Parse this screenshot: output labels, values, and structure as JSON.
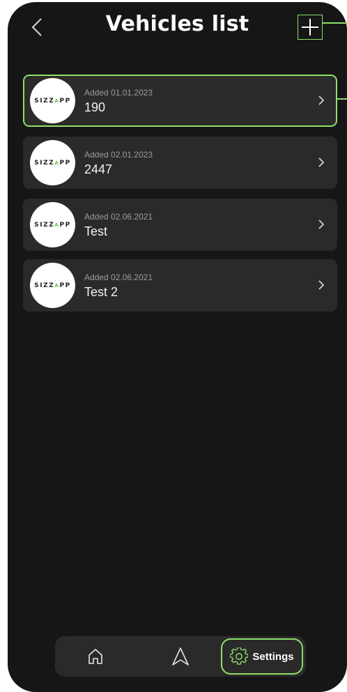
{
  "header": {
    "title": "Vehicles list",
    "back_icon": "chevron-left-icon",
    "add_icon": "plus-icon"
  },
  "vehicles": [
    {
      "logo": "SIZZAPP",
      "added": "Added 01.01.2023",
      "name": "190",
      "selected": true
    },
    {
      "logo": "SIZZAPP",
      "added": "Added 02.01.2023",
      "name": "2447",
      "selected": false
    },
    {
      "logo": "SIZZAPP",
      "added": "Added 02.06.2021",
      "name": "Test",
      "selected": false
    },
    {
      "logo": "SIZZAPP",
      "added": "Added 02.06.2021",
      "name": "Test 2",
      "selected": false
    }
  ],
  "tabbar": {
    "home_icon": "home-icon",
    "navigate_icon": "navigation-arrow-icon",
    "settings_icon": "gear-icon",
    "settings_label": "Settings"
  },
  "colors": {
    "background": "#161616",
    "card": "#2a2a2a",
    "accent": "#8ee06a",
    "text": "#ffffff",
    "muted": "#9c9c9c"
  }
}
